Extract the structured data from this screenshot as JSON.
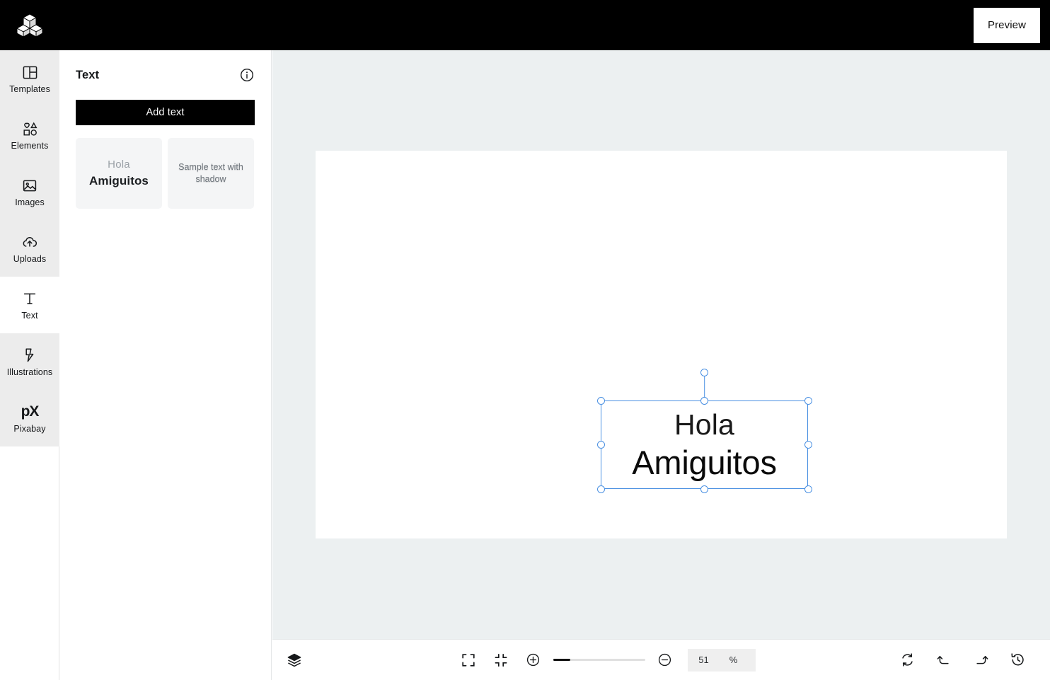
{
  "topbar": {
    "logo_name": "cubes-logo",
    "preview_label": "Preview"
  },
  "sidebar": {
    "items": [
      {
        "label": "Templates",
        "icon": "templates-icon",
        "active": false
      },
      {
        "label": "Elements",
        "icon": "elements-icon",
        "active": false
      },
      {
        "label": "Images",
        "icon": "images-icon",
        "active": false
      },
      {
        "label": "Uploads",
        "icon": "uploads-icon",
        "active": false
      },
      {
        "label": "Text",
        "icon": "text-icon",
        "active": true
      },
      {
        "label": "Illustrations",
        "icon": "illustrations-icon",
        "active": false
      },
      {
        "label": "Pixabay",
        "icon": "pixabay-icon",
        "active": false,
        "mark": "pX"
      }
    ]
  },
  "panel": {
    "title": "Text",
    "info_icon": "info-icon",
    "add_text_label": "Add text",
    "presets": [
      {
        "line1": "Hola",
        "line2": "Amiguitos",
        "style": "two-line"
      },
      {
        "line1": "Sample text with shadow",
        "style": "shadow"
      }
    ]
  },
  "canvas": {
    "selected_text": {
      "line1": "Hola",
      "line2": "Amiguitos"
    }
  },
  "bottombar": {
    "layers_label": "layers-icon",
    "fit_label": "fit-to-screen-icon",
    "collapse_label": "collapse-icon",
    "zoom_in_label": "zoom-in-icon",
    "zoom_out_label": "zoom-out-icon",
    "zoom_value": "51",
    "zoom_unit": "%",
    "refresh_label": "refresh-icon",
    "undo_label": "undo-icon",
    "redo_label": "redo-icon",
    "history_label": "history-icon"
  },
  "colors": {
    "accent": "#4a90e2",
    "topbar_bg": "#000000",
    "rail_bg": "#ececec",
    "workspace_bg": "#ecf0f1",
    "canvas_bg": "#ffffff"
  }
}
